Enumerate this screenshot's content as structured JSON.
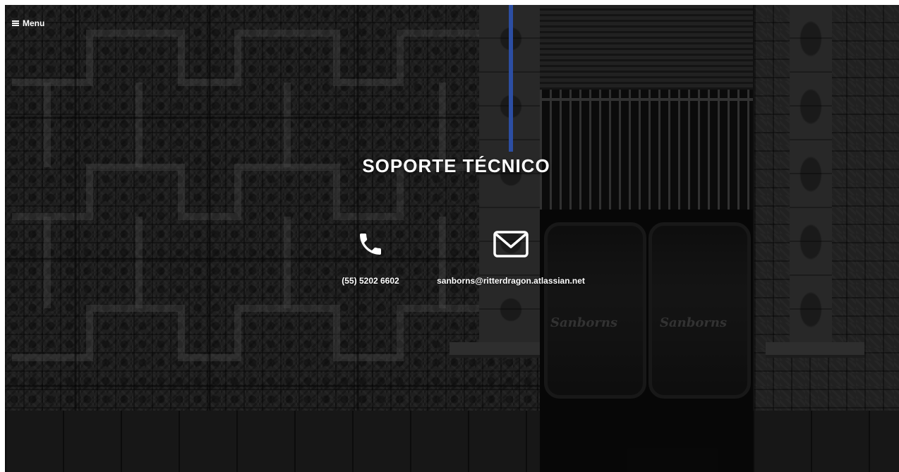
{
  "header": {
    "menu_label": "Menu",
    "menu_icon": "hamburger-icon"
  },
  "hero": {
    "title": "SOPORTE TÉCNICO",
    "accent_color": "#2c4ea3",
    "background": "dark tiled wall with storefront"
  },
  "contacts": [
    {
      "icon": "phone-icon",
      "label": "(55) 5202 6602"
    },
    {
      "icon": "envelope-icon",
      "label": "sanborns@ritterdragon.atlassian.net"
    }
  ],
  "scene": {
    "shop_sign_left": "Sanborns",
    "shop_sign_right": "Sanborns"
  }
}
